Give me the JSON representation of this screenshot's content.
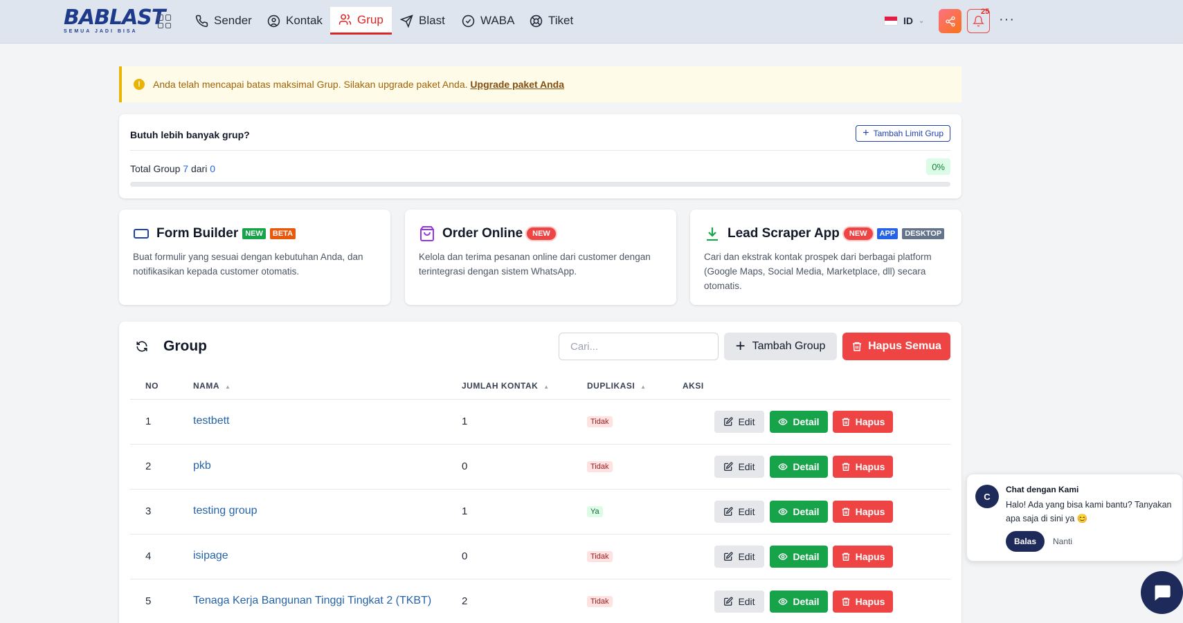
{
  "brand": {
    "logo_main": "BABLAST",
    "logo_tagline": "SEMUA JADI BISA"
  },
  "nav": {
    "items": [
      {
        "label": "Sender",
        "icon": "phone-icon"
      },
      {
        "label": "Kontak",
        "icon": "user-circle-icon"
      },
      {
        "label": "Grup",
        "icon": "users-icon",
        "active": true
      },
      {
        "label": "Blast",
        "icon": "send-icon"
      },
      {
        "label": "WABA",
        "icon": "check-circle-icon"
      },
      {
        "label": "Tiket",
        "icon": "lifebuoy-icon"
      }
    ],
    "language": "ID",
    "notification_count": "25",
    "more": "···"
  },
  "alert": {
    "text": "Anda telah mencapai batas maksimal Grup. Silakan upgrade paket Anda.",
    "link": "Upgrade paket Anda",
    "icon": "!"
  },
  "limit": {
    "title": "Butuh lebih banyak grup?",
    "add_button": "Tambah Limit Grup",
    "total_label": "Total Group",
    "used": "7",
    "of_label": "dari",
    "max": "0",
    "percent": "0%"
  },
  "features": [
    {
      "title": "Form Builder",
      "tags": [
        "NEW",
        "BETA"
      ],
      "desc": "Buat formulir yang sesuai dengan kebutuhan Anda, dan notifikasikan kepada customer otomatis."
    },
    {
      "title": "Order Online",
      "tags": [
        "NEW"
      ],
      "desc": "Kelola dan terima pesanan online dari customer dengan terintegrasi dengan sistem WhatsApp."
    },
    {
      "title": "Lead Scraper App",
      "tags": [
        "NEW",
        "APP",
        "DESKTOP"
      ],
      "desc": "Cari dan ekstrak kontak prospek dari berbagai platform (Google Maps, Social Media, Marketplace, dll) secara otomatis."
    }
  ],
  "group": {
    "title": "Group",
    "search_placeholder": "Cari...",
    "add_button": "Tambah Group",
    "delete_all_button": "Hapus Semua",
    "columns": [
      "NO",
      "NAMA",
      "JUMLAH KONTAK",
      "DUPLIKASI",
      "AKSI"
    ],
    "rows": [
      {
        "no": "1",
        "name": "testbett",
        "count": "1",
        "dup": "Tidak"
      },
      {
        "no": "2",
        "name": "pkb",
        "count": "0",
        "dup": "Tidak"
      },
      {
        "no": "3",
        "name": "testing group",
        "count": "1",
        "dup": "Ya"
      },
      {
        "no": "4",
        "name": "isipage",
        "count": "0",
        "dup": "Tidak"
      },
      {
        "no": "5",
        "name": "Tenaga Kerja Bangunan Tinggi Tingkat 2 (TKBT)",
        "count": "2",
        "dup": "Tidak"
      }
    ],
    "actions": {
      "edit": "Edit",
      "detail": "Detail",
      "delete": "Hapus"
    }
  },
  "chat": {
    "avatar": "C",
    "title": "Chat dengan Kami",
    "message": "Halo! Ada yang bisa kami bantu? Tanyakan apa saja di sini ya 😊",
    "reply": "Balas",
    "later": "Nanti"
  },
  "colors": {
    "primary_red": "#ef4444",
    "success_green": "#16a34a",
    "navy": "#1e2a5a",
    "link_blue": "#2563a8"
  }
}
